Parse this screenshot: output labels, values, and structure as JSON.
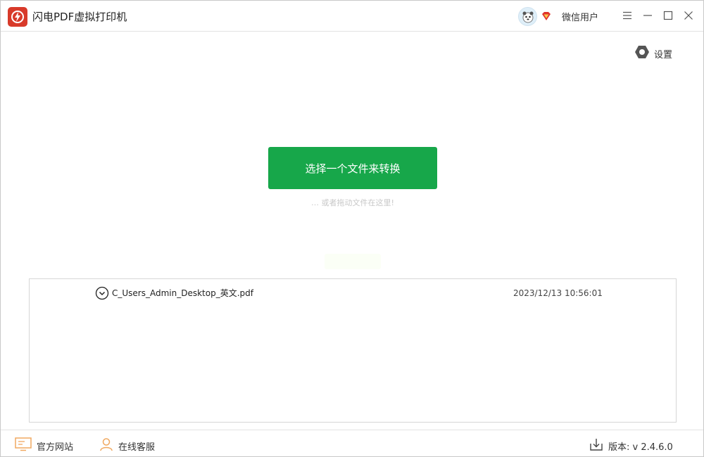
{
  "titlebar": {
    "app_title": "闪电PDF虚拟打印机",
    "user_name": "微信用户"
  },
  "settings": {
    "label": "设置"
  },
  "main": {
    "convert_button_label": "选择一个文件来转换",
    "drag_hint": "… 或者拖动文件在这里!"
  },
  "file_list": {
    "rows": [
      {
        "name": "C_Users_Admin_Desktop_英文.pdf",
        "time": "2023/12/13 10:56:01"
      }
    ]
  },
  "footer": {
    "website_label": "官方网站",
    "support_label": "在线客服",
    "version_label": "版本:  v 2.4.6.0"
  },
  "colors": {
    "accent": "#17a74a",
    "logo": "#d83a2a",
    "footer_icon": "#f0a860"
  },
  "icons": [
    "app-logo-icon",
    "avatar-icon",
    "vip-diamond-icon",
    "menu-icon",
    "minimize-icon",
    "maximize-icon",
    "close-icon",
    "settings-hex-icon",
    "expand-chevron-icon",
    "monitor-icon",
    "person-icon",
    "download-icon"
  ]
}
